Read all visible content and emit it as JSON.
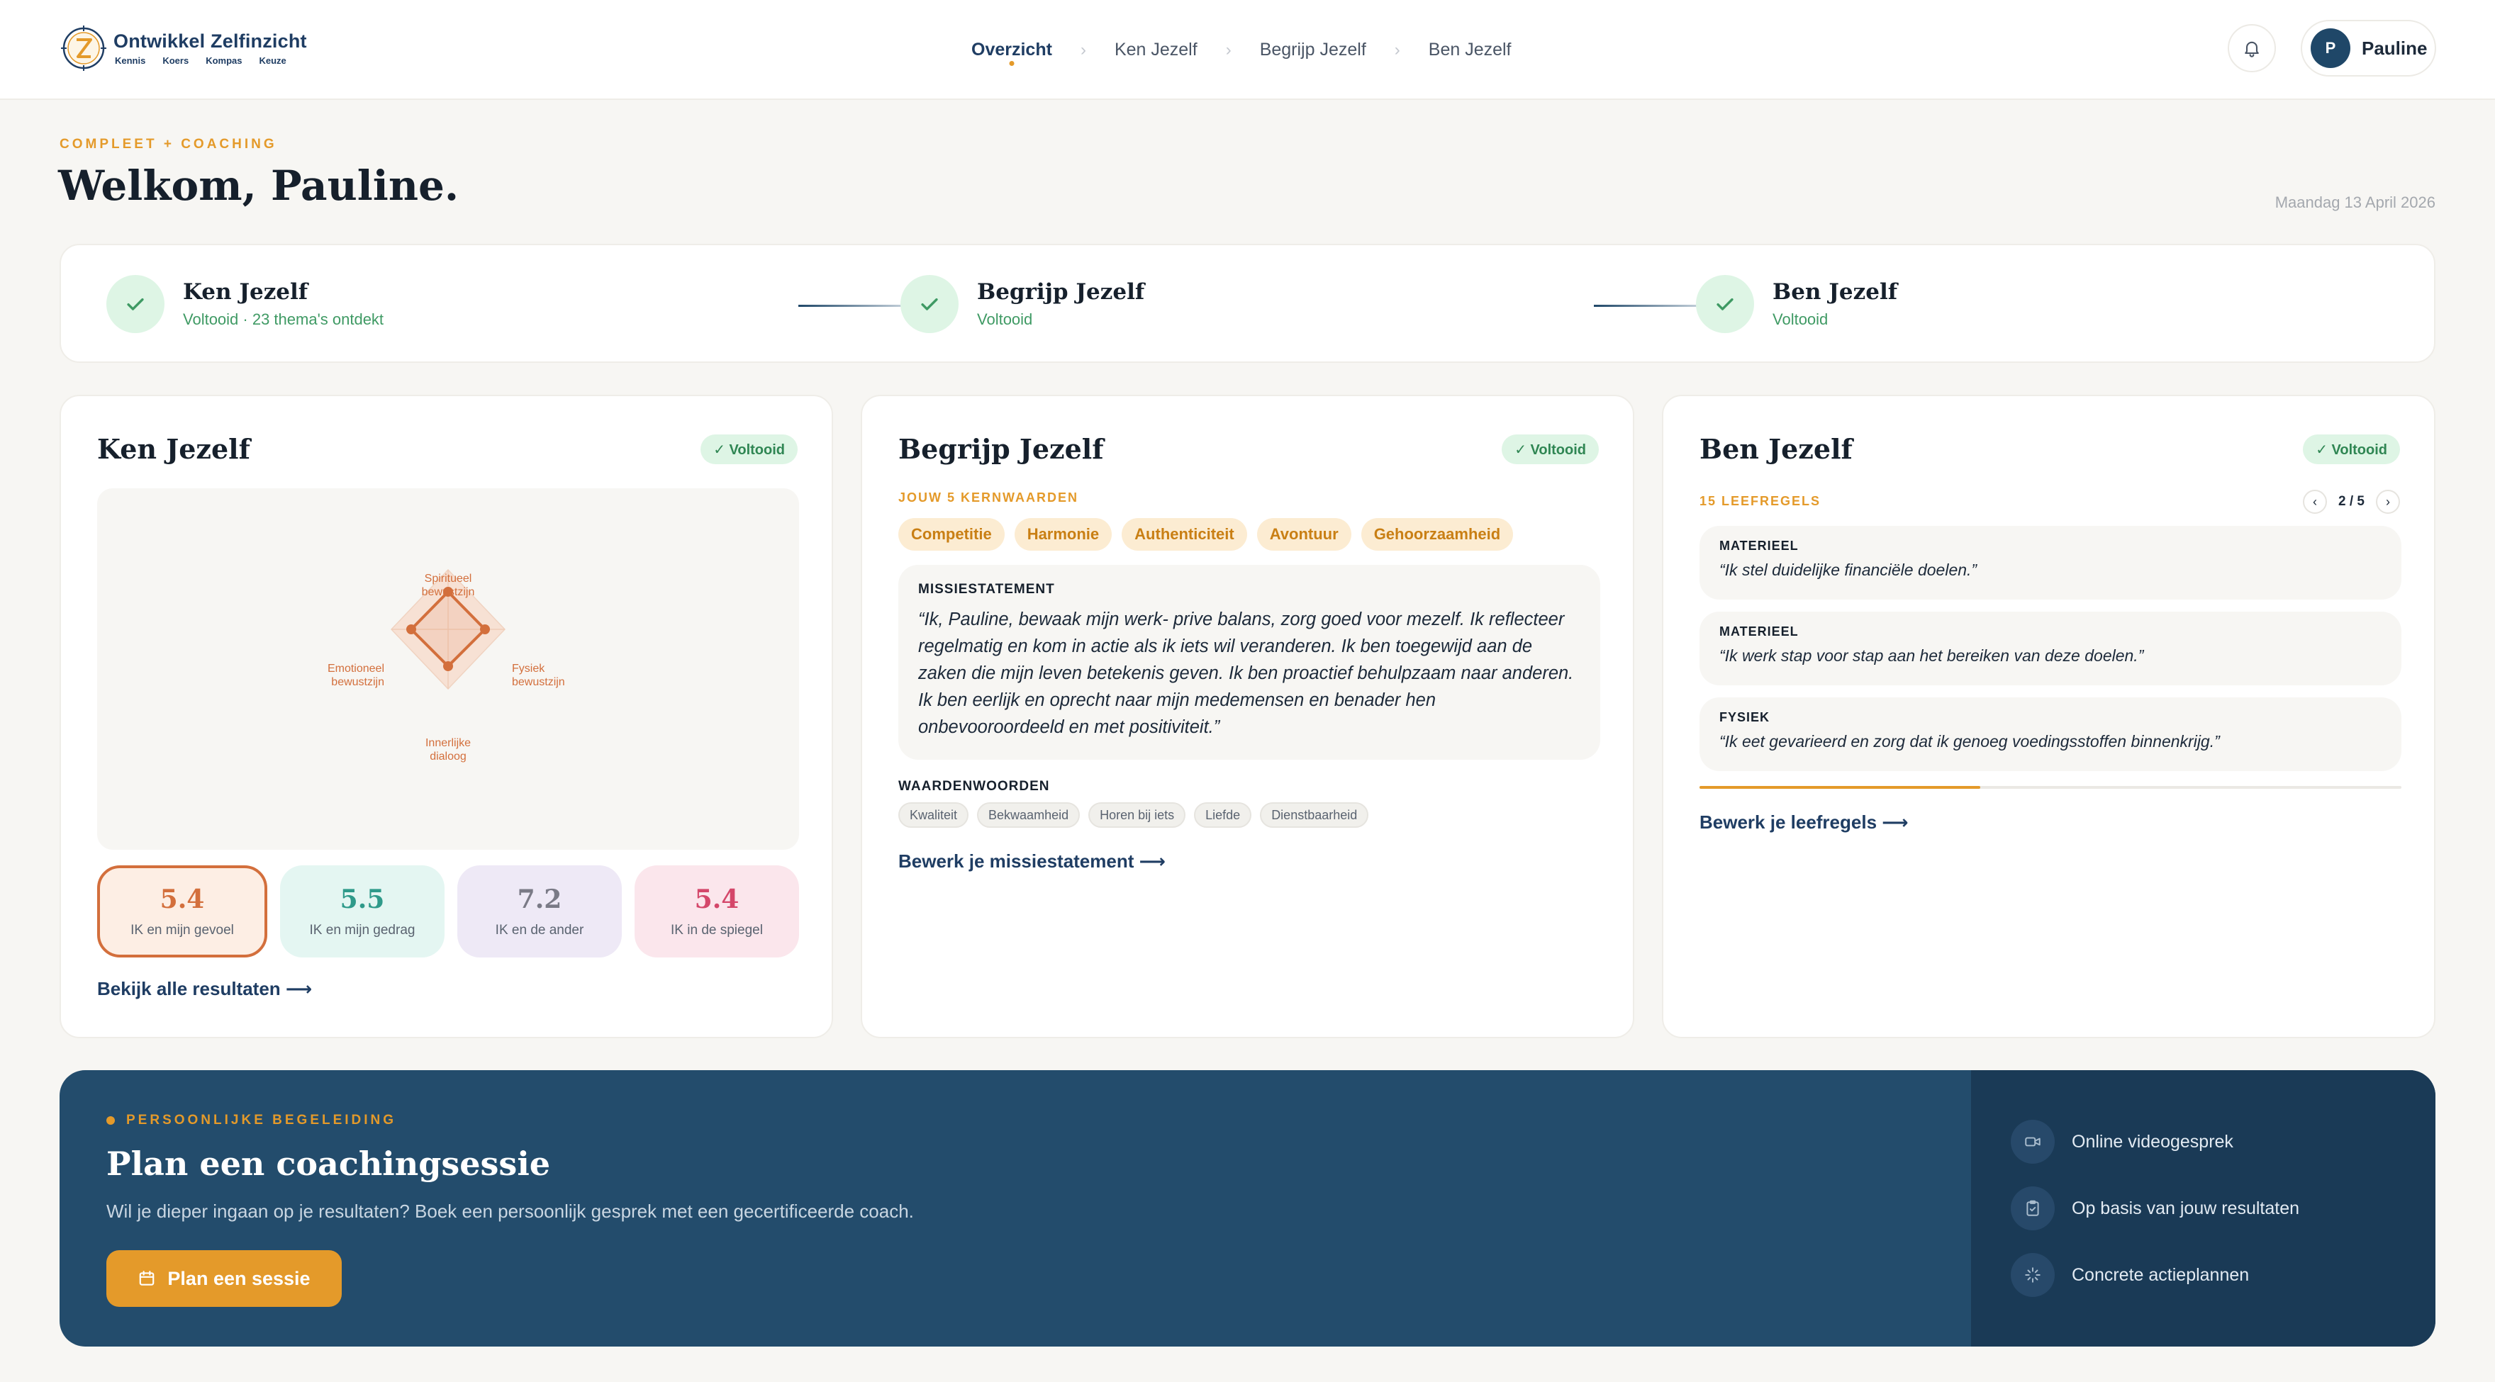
{
  "header": {
    "logo_title": "Ontwikkel Zelfinzicht",
    "logo_sub": [
      "Kennis",
      "Koers",
      "Kompas",
      "Keuze"
    ],
    "nav": [
      {
        "label": "Overzicht",
        "active": true
      },
      {
        "label": "Ken Jezelf",
        "active": false
      },
      {
        "label": "Begrijp Jezelf",
        "active": false
      },
      {
        "label": "Ben Jezelf",
        "active": false
      }
    ],
    "user": {
      "initial": "P",
      "name": "Pauline"
    }
  },
  "welcome": {
    "eyebrow": "COMPLEET + COACHING",
    "title": "Welkom, Pauline.",
    "date": "Maandag 13 April 2026"
  },
  "progress": [
    {
      "title": "Ken Jezelf",
      "status": "Voltooid · 23 thema's ontdekt"
    },
    {
      "title": "Begrijp Jezelf",
      "status": "Voltooid"
    },
    {
      "title": "Ben Jezelf",
      "status": "Voltooid"
    }
  ],
  "ken": {
    "title": "Ken Jezelf",
    "badge": "✓ Voltooid",
    "radar": {
      "top": [
        "Spiritueel",
        "bewustzijn"
      ],
      "right": [
        "Fysiek",
        "bewustzijn"
      ],
      "bottom": [
        "Innerlijke",
        "dialoog"
      ],
      "left": [
        "Emotioneel",
        "bewustzijn"
      ]
    },
    "scores": [
      {
        "value": "5.4",
        "label": "IK en mijn gevoel"
      },
      {
        "value": "5.5",
        "label": "IK en mijn gedrag"
      },
      {
        "value": "7.2",
        "label": "IK en de ander"
      },
      {
        "value": "5.4",
        "label": "IK in de spiegel"
      }
    ],
    "link": "Bekijk alle resultaten ⟶"
  },
  "begrijp": {
    "title": "Begrijp Jezelf",
    "badge": "✓ Voltooid",
    "values_label": "JOUW 5 KERNWAARDEN",
    "values": [
      "Competitie",
      "Harmonie",
      "Authenticiteit",
      "Avontuur",
      "Gehoorzaamheid"
    ],
    "mission_label": "MISSIESTATEMENT",
    "mission_text": "“Ik, Pauline, bewaak mijn werk- prive balans, zorg goed voor mezelf. Ik reflecteer regelmatig en kom in actie als ik iets wil veranderen. Ik ben toegewijd aan de zaken die mijn leven betekenis geven. Ik ben proactief behulpzaam naar anderen. Ik ben eerlijk en oprecht naar mijn medemensen en benader hen onbevooroordeeld en met positiviteit.”",
    "words_label": "WAARDENWOORDEN",
    "words": [
      "Kwaliteit",
      "Bekwaamheid",
      "Horen bij iets",
      "Liefde",
      "Dienstbaarheid"
    ],
    "link": "Bewerk je missiestatement ⟶"
  },
  "ben": {
    "title": "Ben Jezelf",
    "badge": "✓ Voltooid",
    "rules_label": "15 LEEFREGELS",
    "pager": "2 / 5",
    "progress_fraction": 0.4,
    "rules": [
      {
        "category": "MATERIEEL",
        "text": "“Ik stel duidelijke financiële doelen.”"
      },
      {
        "category": "MATERIEEL",
        "text": "“Ik werk stap voor stap aan het bereiken van deze doelen.”"
      },
      {
        "category": "FYSIEK",
        "text": "“Ik eet gevarieerd en zorg dat ik genoeg voedingsstoffen binnenkrijg.”"
      }
    ],
    "link": "Bewerk je leefregels ⟶"
  },
  "banner": {
    "eyebrow": "PERSOONLIJKE BEGELEIDING",
    "title": "Plan een coachingsessie",
    "desc": "Wil je dieper ingaan op je resultaten? Boek een persoonlijk gesprek met een gecertificeerde coach.",
    "cta": "Plan een sessie",
    "features": [
      {
        "icon": "video-icon",
        "label": "Online videogesprek"
      },
      {
        "icon": "clipboard-icon",
        "label": "Op basis van jouw resultaten"
      },
      {
        "icon": "sparkle-icon",
        "label": "Concrete actieplannen"
      }
    ]
  },
  "colors": {
    "accent": "#e49a2a",
    "navy": "#1f3d63",
    "success": "#2f8653",
    "banner": "#234c6c"
  }
}
